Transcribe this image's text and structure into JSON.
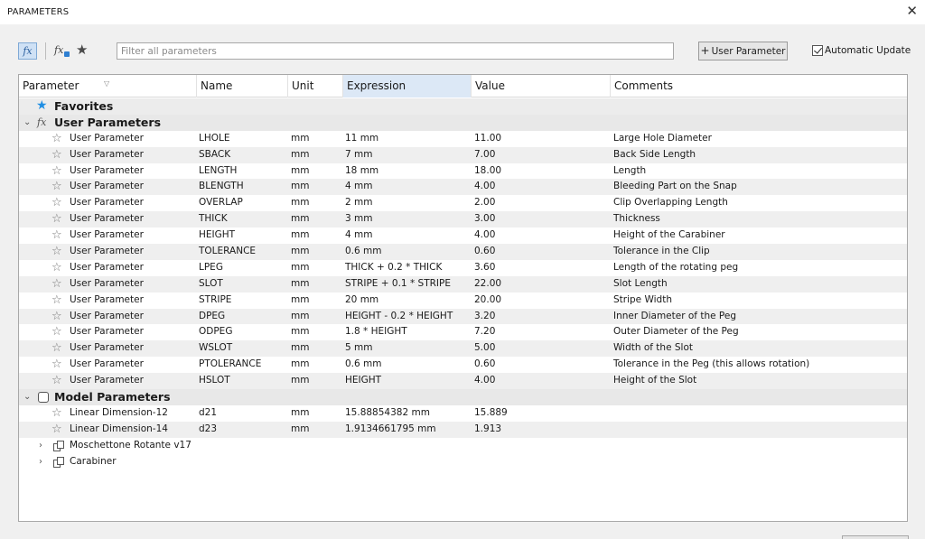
{
  "window": {
    "title": "PARAMETERS",
    "close_glyph": "✕"
  },
  "toolbar": {
    "fx_label": "fx",
    "filter_placeholder": "Filter all parameters",
    "user_param_label": "User Parameter",
    "auto_update_label": "Automatic Update",
    "auto_update_checked": true
  },
  "columns": [
    "Parameter",
    "Name",
    "Unit",
    "Expression",
    "Value",
    "Comments"
  ],
  "groups": {
    "favorites": "Favorites",
    "user": "User Parameters",
    "model": "Model Parameters"
  },
  "user_params": [
    {
      "param": "User Parameter",
      "name": "LHOLE",
      "unit": "mm",
      "expr": "11 mm",
      "value": "11.00",
      "comment": "Large Hole Diameter"
    },
    {
      "param": "User Parameter",
      "name": "SBACK",
      "unit": "mm",
      "expr": "7 mm",
      "value": "7.00",
      "comment": "Back Side Length"
    },
    {
      "param": "User Parameter",
      "name": "LENGTH",
      "unit": "mm",
      "expr": "18 mm",
      "value": "18.00",
      "comment": "Length"
    },
    {
      "param": "User Parameter",
      "name": "BLENGTH",
      "unit": "mm",
      "expr": "4 mm",
      "value": "4.00",
      "comment": "Bleeding Part on the Snap"
    },
    {
      "param": "User Parameter",
      "name": "OVERLAP",
      "unit": "mm",
      "expr": "2 mm",
      "value": "2.00",
      "comment": "Clip Overlapping Length"
    },
    {
      "param": "User Parameter",
      "name": "THICK",
      "unit": "mm",
      "expr": "3 mm",
      "value": "3.00",
      "comment": "Thickness"
    },
    {
      "param": "User Parameter",
      "name": "HEIGHT",
      "unit": "mm",
      "expr": "4 mm",
      "value": "4.00",
      "comment": "Height of the Carabiner"
    },
    {
      "param": "User Parameter",
      "name": "TOLERANCE",
      "unit": "mm",
      "expr": "0.6 mm",
      "value": "0.60",
      "comment": "Tolerance in the Clip"
    },
    {
      "param": "User Parameter",
      "name": "LPEG",
      "unit": "mm",
      "expr": "THICK + 0.2 * THICK",
      "value": "3.60",
      "comment": "Length of the rotating peg"
    },
    {
      "param": "User Parameter",
      "name": "SLOT",
      "unit": "mm",
      "expr": "STRIPE + 0.1 * STRIPE",
      "value": "22.00",
      "comment": "Slot Length"
    },
    {
      "param": "User Parameter",
      "name": "STRIPE",
      "unit": "mm",
      "expr": "20 mm",
      "value": "20.00",
      "comment": "Stripe Width"
    },
    {
      "param": "User Parameter",
      "name": "DPEG",
      "unit": "mm",
      "expr": "HEIGHT - 0.2 * HEIGHT",
      "value": "3.20",
      "comment": "Inner Diameter of the Peg"
    },
    {
      "param": "User Parameter",
      "name": "ODPEG",
      "unit": "mm",
      "expr": "1.8 * HEIGHT",
      "value": "7.20",
      "comment": "Outer Diameter of the Peg"
    },
    {
      "param": "User Parameter",
      "name": "WSLOT",
      "unit": "mm",
      "expr": "5 mm",
      "value": "5.00",
      "comment": "Width of the Slot"
    },
    {
      "param": "User Parameter",
      "name": "PTOLERANCE",
      "unit": "mm",
      "expr": "0.6 mm",
      "value": "0.60",
      "comment": "Tolerance in the Peg (this allows rotation)"
    },
    {
      "param": "User Parameter",
      "name": "HSLOT",
      "unit": "mm",
      "expr": "HEIGHT",
      "value": "4.00",
      "comment": "Height of the Slot"
    }
  ],
  "model_params": [
    {
      "param": "Linear Dimension-12",
      "name": "d21",
      "unit": "mm",
      "expr": "15.88854382 mm",
      "value": "15.889",
      "comment": ""
    },
    {
      "param": "Linear Dimension-14",
      "name": "d23",
      "unit": "mm",
      "expr": "1.9134661795 mm",
      "value": "1.913",
      "comment": ""
    }
  ],
  "components": [
    "Moschettone Rotante v17",
    "Carabiner"
  ],
  "icons": {
    "star_outline": "star-outline-icon",
    "star_filled": "star-filled-icon",
    "chevron_down": "chevron-down-icon",
    "chevron_right": "chevron-right-icon",
    "fx": "fx-icon",
    "model": "model-parameters-icon",
    "component": "component-icon"
  },
  "colors": {
    "accent_blue": "#1f8ee3",
    "header_active": "#dce8f6",
    "row_alt": "#efefef"
  }
}
